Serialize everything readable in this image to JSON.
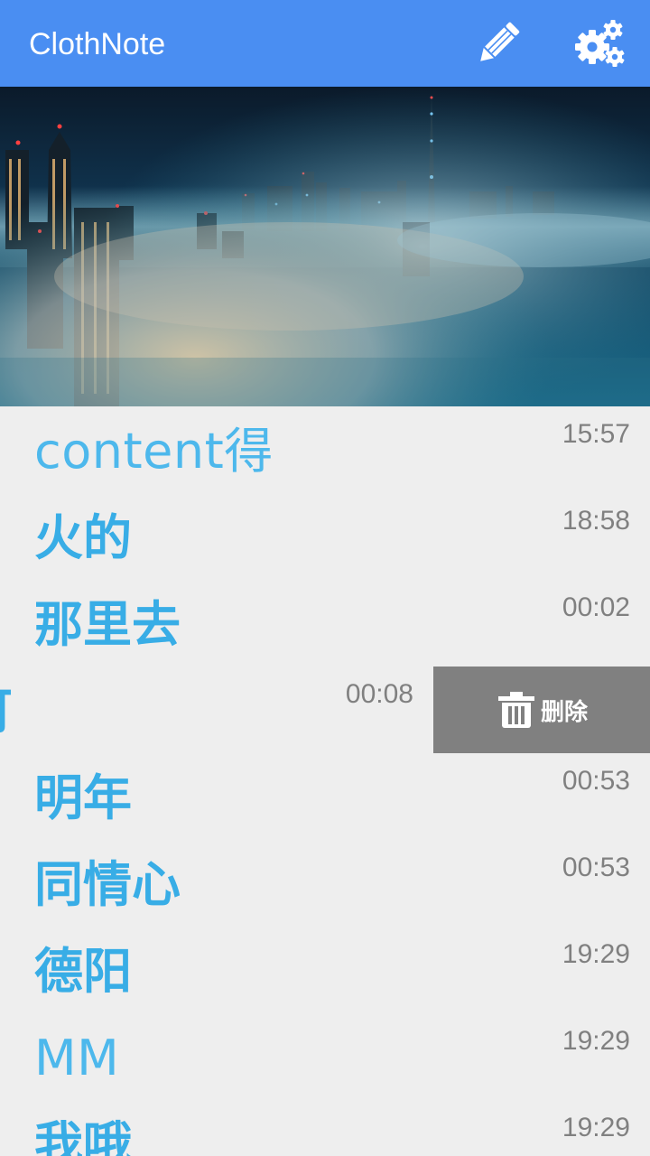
{
  "appbar": {
    "title": "ClothNote",
    "background": "#4a8ef2",
    "edit_icon": "pencil-icon",
    "settings_icon": "gears-icon"
  },
  "hero": {
    "description_icon": "city-fog-header-image"
  },
  "notes": [
    {
      "title": "content得",
      "time": "15:57",
      "style": "light"
    },
    {
      "title": "火的",
      "time": "18:58",
      "style": "bold"
    },
    {
      "title": "那里去",
      "time": "00:02",
      "style": "bold"
    },
    {
      "title": "摸棱两可",
      "time": "00:08",
      "style": "bold",
      "swiped": true
    },
    {
      "title": "明年",
      "time": "00:53",
      "style": "bold"
    },
    {
      "title": "同情心",
      "time": "00:53",
      "style": "bold"
    },
    {
      "title": "德阳",
      "time": "19:29",
      "style": "bold"
    },
    {
      "title": "MM",
      "time": "19:29",
      "style": "light"
    },
    {
      "title": "我哦",
      "time": "19:29",
      "style": "bold"
    }
  ],
  "swipe_action": {
    "label": "删除",
    "icon": "trash-icon",
    "background": "#808080"
  },
  "colors": {
    "note_title": "#38ade6",
    "note_time": "#808080",
    "list_background": "#eeeeee"
  }
}
